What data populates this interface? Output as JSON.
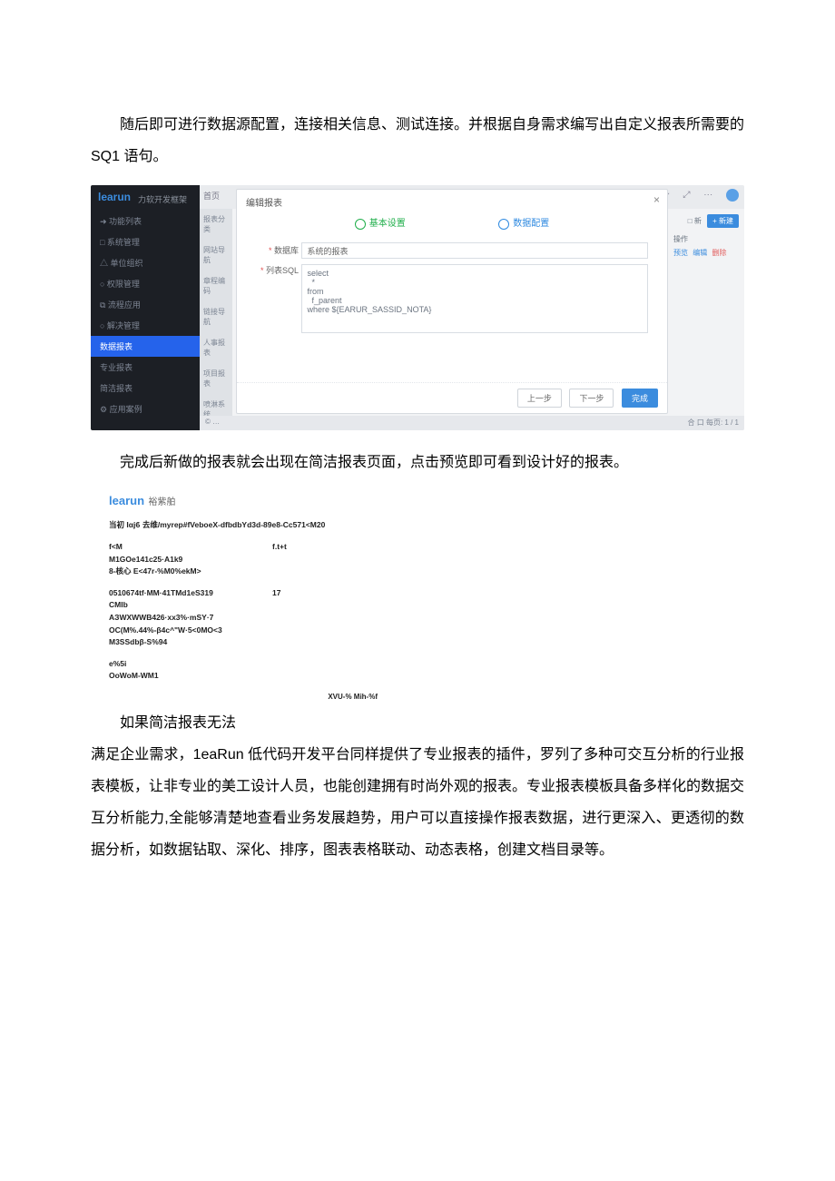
{
  "para1": "随后即可进行数据源配置，连接相关信息、测试连接。并根据自身需求编写出自定义报表所需要的 SQ1 语句。",
  "para2": "完成后新做的报表就会出现在简洁报表页面，点击预览即可看到设计好的报表。",
  "para3_lead": "如果简洁报表无法",
  "para3_body": "满足企业需求，1eaRun 低代码开发平台同样提供了专业报表的插件，罗列了多种可交互分析的行业报表模板，让非专业的美工设计人员，也能创建拥有时尚外观的报表。专业报表模板具备多样化的数据交互分析能力,全能够清楚地查看业务发展趋势，用户可以直接操作报表数据，进行更深入、更透彻的数据分析，如数据钻取、深化、排序，图表表格联动、动态表格，创建文档目录等。",
  "shot1": {
    "logo": "learun",
    "logo_sub": "力软开发框架",
    "sidebar": [
      "➜ 功能列表",
      "□ 系统管理",
      "△ 单位组织",
      "○ 权限管理",
      "⧉ 流程应用",
      "○ 解决管理",
      "数据报表",
      "专业报表",
      "简洁报表",
      "⚙ 应用案例"
    ],
    "sidebar_active_index": 6,
    "top_home": "首页",
    "leftcol2": [
      "报表分类",
      "网站导航",
      "章程编码",
      "链接导航",
      "人事报表",
      "项目报表",
      "喷淋系统"
    ],
    "modal": {
      "title": "编辑报表",
      "step1": "基本设置",
      "step2": "数据配置",
      "label_db": "数据库",
      "db_value": "系统的报表",
      "label_sql": "列表SQL",
      "sql_value": "select\n  *\nfrom\n  f_parent\nwhere ${EARUR_SASSID_NOTA}",
      "btn_prev": "上一步",
      "btn_next": "下一步",
      "btn_done": "完成"
    },
    "rightbar": {
      "txtbt": "□ 新",
      "bt": "+ 新建",
      "hdr": "操作",
      "op_edit": "预览",
      "op_mod": "编辑",
      "op_del": "删除"
    },
    "status_left": "© …",
    "status_right": "合 口   每页: 1   / 1"
  },
  "shot2": {
    "brand": "learun",
    "brand_sub": "裕紫舶",
    "bar": "当初 Iαjϐ 去维/myrep#fVeboeX-dfbdbYd3d-89e8-Cc571<M20",
    "block1": {
      "r1c1": "f<M",
      "r1c2": "f.t+t",
      "r2": "M1GOe141c25·A1k9",
      "r3": "8-核心 E<47r-%M0%ekM>"
    },
    "block2": {
      "r1c1": "0510674tf·MM·41TMd1eS319",
      "r1c2": "17",
      "r2": "CMIb",
      "r3": "AЗWXWWB426·xx3%·mSY·7",
      "r4": "OC(M%.44%-β4c^\"W·5<0MO<3",
      "r5": "M3SSdbβ-S%94"
    },
    "block3": {
      "r1": "e%5i",
      "r2": "OoWoM-WM1"
    },
    "foot": "XVU-% Mih-%f"
  }
}
